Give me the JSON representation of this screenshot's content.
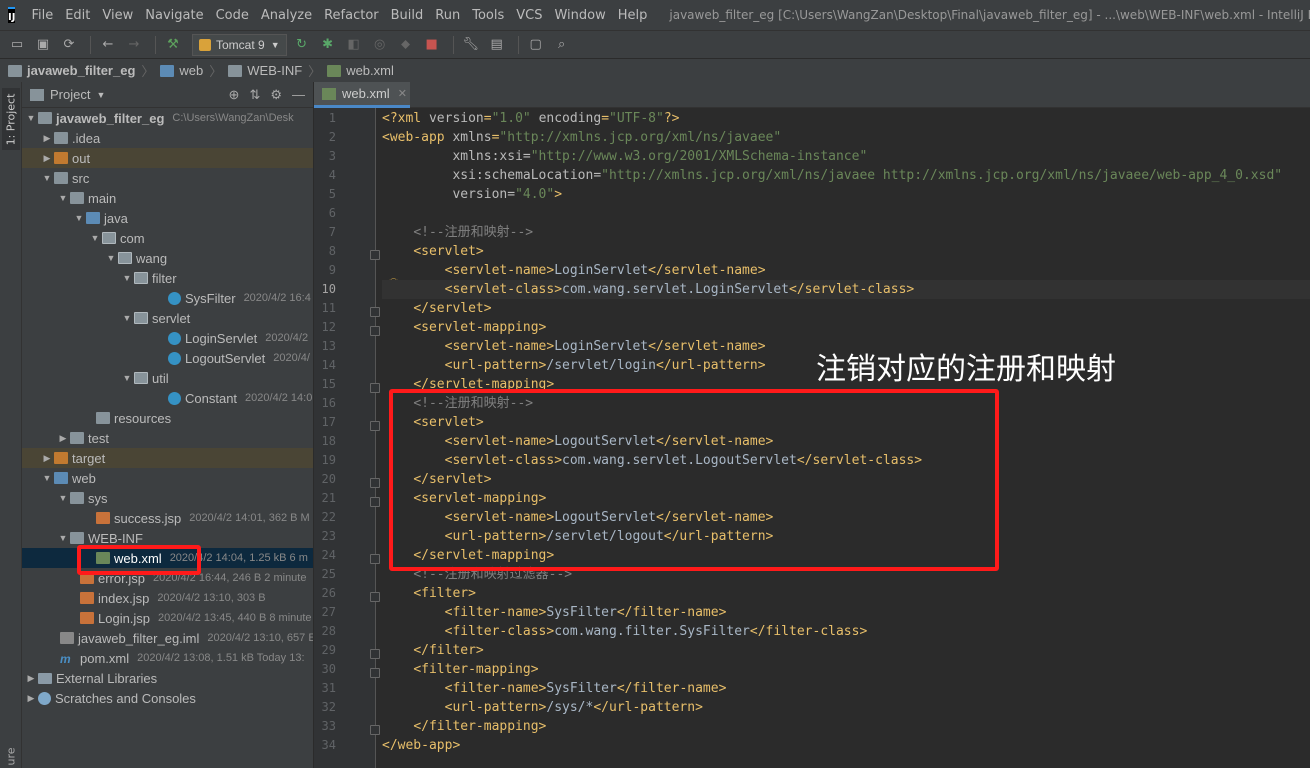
{
  "menubar": {
    "items": [
      "File",
      "Edit",
      "View",
      "Navigate",
      "Code",
      "Analyze",
      "Refactor",
      "Build",
      "Run",
      "Tools",
      "VCS",
      "Window",
      "Help"
    ],
    "title": "javaweb_filter_eg [C:\\Users\\WangZan\\Desktop\\Final\\javaweb_filter_eg] - ...\\web\\WEB-INF\\web.xml - IntelliJ IDEA"
  },
  "toolbar": {
    "run_config": "Tomcat 9"
  },
  "breadcrumb": [
    "javaweb_filter_eg",
    "web",
    "WEB-INF",
    "web.xml"
  ],
  "left_strip": {
    "project_tab": "1: Project",
    "bottom_tab": "ure"
  },
  "project_panel": {
    "title": "Project",
    "rows": [
      {
        "name": "javaweb_filter_eg",
        "meta": "C:\\Users\\WangZan\\Desk"
      },
      {
        "name": ".idea",
        "meta": ""
      },
      {
        "name": "out",
        "meta": ""
      },
      {
        "name": "src",
        "meta": ""
      },
      {
        "name": "main",
        "meta": ""
      },
      {
        "name": "java",
        "meta": ""
      },
      {
        "name": "com",
        "meta": ""
      },
      {
        "name": "wang",
        "meta": ""
      },
      {
        "name": "filter",
        "meta": ""
      },
      {
        "name": "SysFilter",
        "meta": "2020/4/2 16:4"
      },
      {
        "name": "servlet",
        "meta": ""
      },
      {
        "name": "LoginServlet",
        "meta": "2020/4/2"
      },
      {
        "name": "LogoutServlet",
        "meta": "2020/4/"
      },
      {
        "name": "util",
        "meta": ""
      },
      {
        "name": "Constant",
        "meta": "2020/4/2 14:0"
      },
      {
        "name": "resources",
        "meta": ""
      },
      {
        "name": "test",
        "meta": ""
      },
      {
        "name": "target",
        "meta": ""
      },
      {
        "name": "web",
        "meta": ""
      },
      {
        "name": "sys",
        "meta": ""
      },
      {
        "name": "success.jsp",
        "meta": "2020/4/2 14:01, 362 B M"
      },
      {
        "name": "WEB-INF",
        "meta": ""
      },
      {
        "name": "web.xml",
        "meta": "2020/4/2 14:04, 1.25 kB 6 m"
      },
      {
        "name": "error.jsp",
        "meta": "2020/4/2 16:44, 246 B 2 minute"
      },
      {
        "name": "index.jsp",
        "meta": "2020/4/2 13:10, 303 B"
      },
      {
        "name": "Login.jsp",
        "meta": "2020/4/2 13:45, 440 B 8 minute"
      },
      {
        "name": "javaweb_filter_eg.iml",
        "meta": "2020/4/2 13:10, 657 E"
      },
      {
        "name": "pom.xml",
        "meta": "2020/4/2 13:08, 1.51 kB Today 13:"
      },
      {
        "name": "External Libraries",
        "meta": ""
      },
      {
        "name": "Scratches and Consoles",
        "meta": ""
      }
    ]
  },
  "editor": {
    "tab": "web.xml",
    "line_numbers": [
      "1",
      "2",
      "3",
      "4",
      "5",
      "6",
      "7",
      "8",
      "9",
      "10",
      "11",
      "12",
      "13",
      "14",
      "15",
      "16",
      "17",
      "18",
      "19",
      "20",
      "21",
      "22",
      "23",
      "24",
      "25",
      "26",
      "27",
      "28",
      "29",
      "30",
      "31",
      "32",
      "33",
      "34"
    ],
    "lines": [
      "<?xml version=\"1.0\" encoding=\"UTF-8\"?>",
      "<web-app xmlns=\"http://xmlns.jcp.org/xml/ns/javaee\"",
      "         xmlns:xsi=\"http://www.w3.org/2001/XMLSchema-instance\"",
      "         xsi:schemaLocation=\"http://xmlns.jcp.org/xml/ns/javaee http://xmlns.jcp.org/xml/ns/javaee/web-app_4_0.xsd\"",
      "         version=\"4.0\">",
      "",
      "    <!--注册和映射-->",
      "    <servlet>",
      "        <servlet-name>LoginServlet</servlet-name>",
      "        <servlet-class>com.wang.servlet.LoginServlet</servlet-class>",
      "    </servlet>",
      "    <servlet-mapping>",
      "        <servlet-name>LoginServlet</servlet-name>",
      "        <url-pattern>/servlet/login</url-pattern>",
      "    </servlet-mapping>",
      "    <!--注册和映射-->",
      "    <servlet>",
      "        <servlet-name>LogoutServlet</servlet-name>",
      "        <servlet-class>com.wang.servlet.LogoutServlet</servlet-class>",
      "    </servlet>",
      "    <servlet-mapping>",
      "        <servlet-name>LogoutServlet</servlet-name>",
      "        <url-pattern>/servlet/logout</url-pattern>",
      "    </servlet-mapping>",
      "    <!--注册和映射过滤器-->",
      "    <filter>",
      "        <filter-name>SysFilter</filter-name>",
      "        <filter-class>com.wang.filter.SysFilter</filter-class>",
      "    </filter>",
      "    <filter-mapping>",
      "        <filter-name>SysFilter</filter-name>",
      "        <url-pattern>/sys/*</url-pattern>",
      "    </filter-mapping>",
      "</web-app>"
    ]
  },
  "annotation": "注销对应的注册和映射",
  "colors": {
    "annotation_box": "#ff1a1a",
    "tag": "#e8bf6a",
    "string": "#6a8759",
    "comment": "#808080"
  }
}
